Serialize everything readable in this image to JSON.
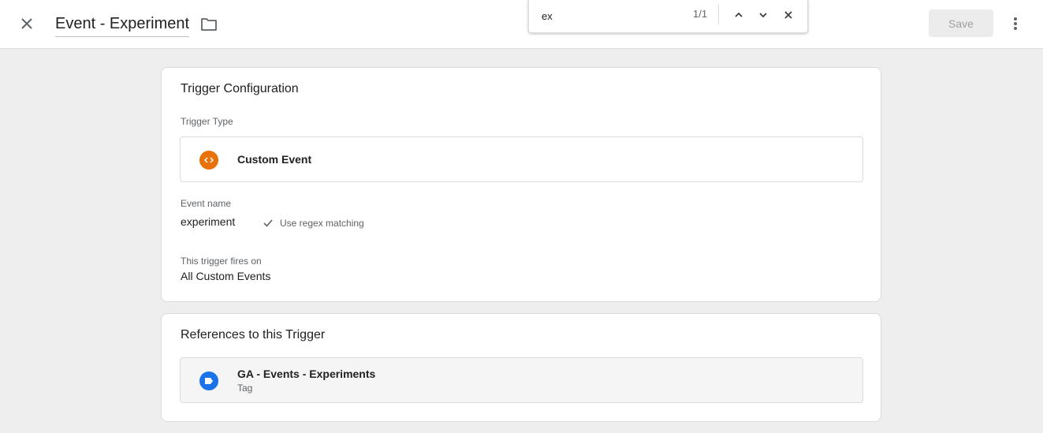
{
  "header": {
    "title": "Event - Experiment",
    "save_label": "Save",
    "icons": [
      "close-icon",
      "folder-icon",
      "more-vert-icon"
    ]
  },
  "find_bar": {
    "query": "ex",
    "match_count": "1/1",
    "icons": [
      "chevron-up-icon",
      "chevron-down-icon",
      "close-icon"
    ]
  },
  "trigger_config": {
    "heading": "Trigger Configuration",
    "trigger_type_label": "Trigger Type",
    "trigger_type_value": "Custom Event",
    "trigger_type_icon": "custom-event-icon",
    "event_name_label": "Event name",
    "event_name_value": "experiment",
    "regex_label": "Use regex matching",
    "fires_on_label": "This trigger fires on",
    "fires_on_value": "All Custom Events"
  },
  "references": {
    "heading": "References to this Trigger",
    "items": [
      {
        "name": "GA - Events - Experiments",
        "type": "Tag",
        "icon": "tag-icon"
      }
    ]
  },
  "colors": {
    "background": "#eeeeee",
    "custom_event_icon": "#e8710a",
    "tag_icon": "#1a73e8",
    "save_disabled_bg": "#ececec",
    "save_disabled_text": "#a0a0a0"
  }
}
